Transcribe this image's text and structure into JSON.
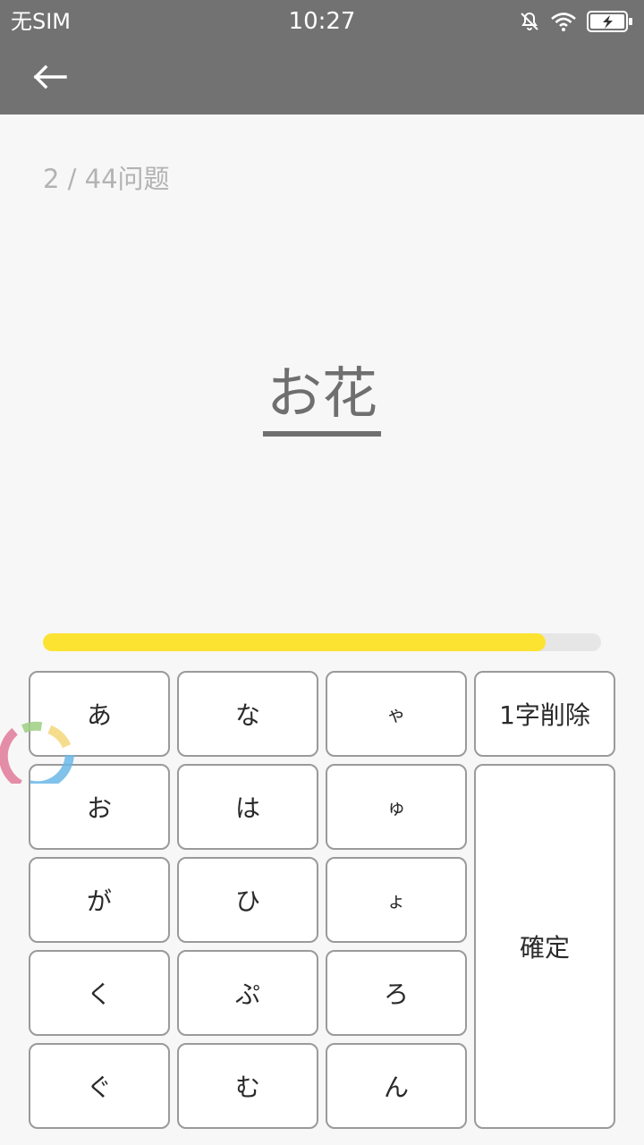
{
  "status_bar": {
    "carrier": "无SIM",
    "time": "10:27",
    "icons": [
      "bell-muted-icon",
      "wifi-icon",
      "battery-charging-icon"
    ]
  },
  "app_bar": {
    "back_icon": "arrow-left-icon"
  },
  "quiz": {
    "progress_text": "2 / 44问题",
    "word": "お花",
    "progress_fraction": 0.9,
    "progress_color": "#fde331"
  },
  "keyboard": {
    "col1": [
      "あ",
      "お",
      "が",
      "く",
      "ぐ"
    ],
    "col2": [
      "な",
      "は",
      "ひ",
      "ぷ",
      "む"
    ],
    "col3": [
      "ゃ",
      "ゅ",
      "ょ",
      "ろ",
      "ん"
    ],
    "delete_label": "1字削除",
    "confirm_label": "確定"
  },
  "colors": {
    "bar_gray": "#727272",
    "background": "#f7f7f7"
  }
}
